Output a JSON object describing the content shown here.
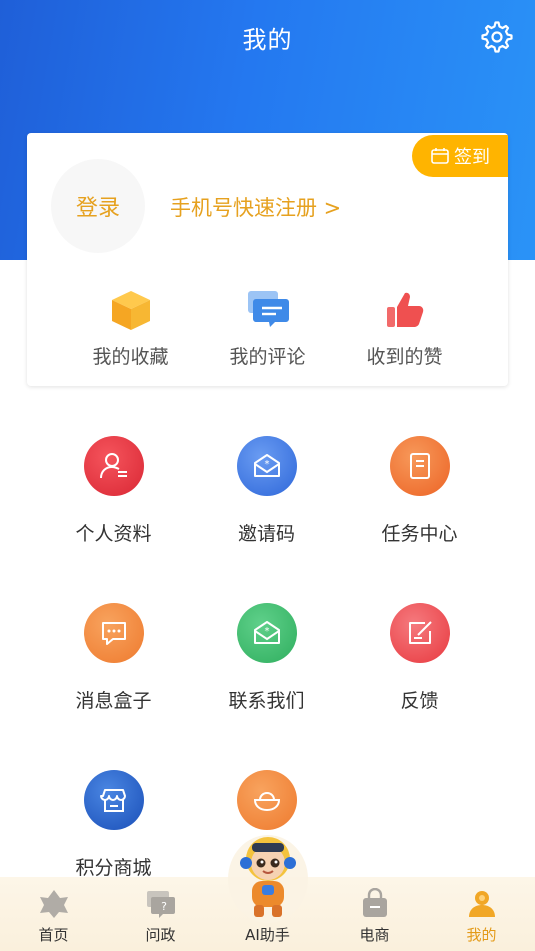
{
  "header": {
    "title": "我的",
    "settings_icon": "gear-icon"
  },
  "profile": {
    "login_label": "登录",
    "register_link": "手机号快速注册 >",
    "checkin_label": "签到",
    "accent_color": "#e6a11f"
  },
  "shortcuts": [
    {
      "label": "我的收藏",
      "icon": "box-icon"
    },
    {
      "label": "我的评论",
      "icon": "comment-icon"
    },
    {
      "label": "收到的赞",
      "icon": "thumbs-up-icon"
    }
  ],
  "grid": [
    {
      "label": "个人资料",
      "icon": "user-profile-icon",
      "color": "#e8333f"
    },
    {
      "label": "邀请码",
      "icon": "invite-mail-icon",
      "color": "#3f7de6"
    },
    {
      "label": "任务中心",
      "icon": "task-icon",
      "color": "#f07a35"
    },
    {
      "label": "消息盒子",
      "icon": "message-icon",
      "color": "#f28a3c"
    },
    {
      "label": "联系我们",
      "icon": "contact-mail-icon",
      "color": "#3dbb6c"
    },
    {
      "label": "反馈",
      "icon": "feedback-icon",
      "color": "#ee5156"
    },
    {
      "label": "积分商城",
      "icon": "store-icon",
      "color": "#2561c8"
    },
    {
      "label": "",
      "icon": "rice-bowl-icon",
      "color": "#f28a3c"
    }
  ],
  "bottom_nav": [
    {
      "label": "首页",
      "icon": "home-icon"
    },
    {
      "label": "问政",
      "icon": "question-chat-icon"
    },
    {
      "label": "AI助手",
      "icon": "ai-mascot-icon"
    },
    {
      "label": "电商",
      "icon": "shopping-bag-icon"
    },
    {
      "label": "我的",
      "icon": "person-icon",
      "active": true
    }
  ]
}
